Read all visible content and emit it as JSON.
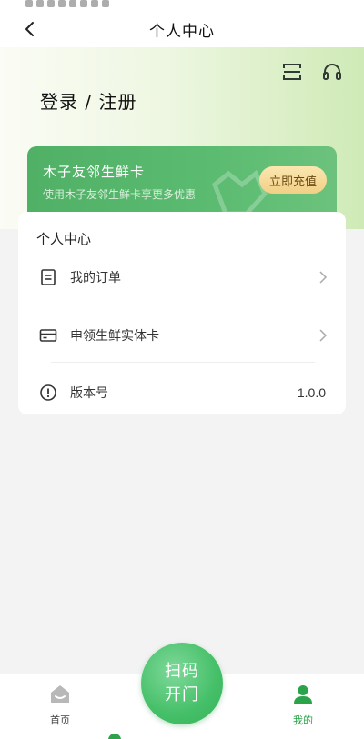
{
  "nav": {
    "title": "个人中心"
  },
  "hero": {
    "login_text": "登录 / 注册"
  },
  "card": {
    "title": "木子友邻生鲜卡",
    "subtitle": "使用木子友邻生鲜卡享更多优惠",
    "button": "立即充值"
  },
  "panel": {
    "title": "个人中心",
    "items": [
      {
        "label": "我的订单",
        "icon": "document-icon"
      },
      {
        "label": "申领生鲜实体卡",
        "icon": "card-icon"
      },
      {
        "label": "版本号",
        "icon": "info-icon",
        "value": "1.0.0"
      }
    ]
  },
  "tabbar": {
    "home_label": "首页",
    "scan_line1": "扫码",
    "scan_line2": "开门",
    "me_label": "我的"
  },
  "colors": {
    "brand_green": "#2aa34a",
    "card_green": "#4fb066",
    "button_gold": "#f2cf86"
  }
}
